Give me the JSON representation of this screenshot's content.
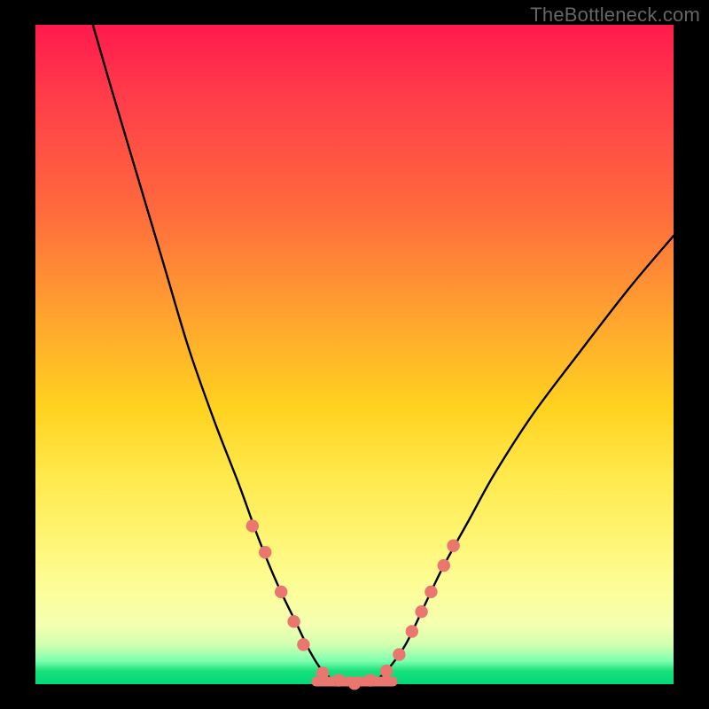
{
  "watermark": "TheBottleneck.com",
  "chart_data": {
    "type": "line",
    "title": "",
    "xlabel": "",
    "ylabel": "",
    "xlim": [
      0,
      100
    ],
    "ylim": [
      0,
      100
    ],
    "series": [
      {
        "name": "bottleneck-curve",
        "x": [
          9,
          12,
          16,
          20,
          24,
          28,
          32,
          35,
          38,
          41,
          43,
          45,
          47,
          49,
          51,
          53,
          55,
          58,
          61,
          64,
          68,
          72,
          78,
          85,
          93,
          100
        ],
        "values": [
          100,
          90,
          77,
          64,
          51,
          40,
          30,
          22,
          15,
          9,
          5,
          2,
          0.5,
          0,
          0,
          0.5,
          2,
          6,
          12,
          18,
          25,
          32,
          41,
          50,
          60,
          68
        ]
      }
    ],
    "markers": {
      "name": "highlight-dots",
      "color": "#e9766f",
      "x": [
        34,
        36,
        38.5,
        40.5,
        42,
        45,
        47.5,
        50,
        52.5,
        55,
        57,
        59,
        60.5,
        62,
        64,
        65.5
      ],
      "values": [
        24,
        20,
        14,
        9.5,
        6,
        1.7,
        0.6,
        0.1,
        0.6,
        2,
        4.5,
        8,
        11,
        14,
        18,
        21
      ]
    },
    "flat_segment": {
      "name": "valley-bar",
      "color": "#e9766f",
      "x_start": 44,
      "x_end": 56,
      "y": 0.4
    }
  }
}
